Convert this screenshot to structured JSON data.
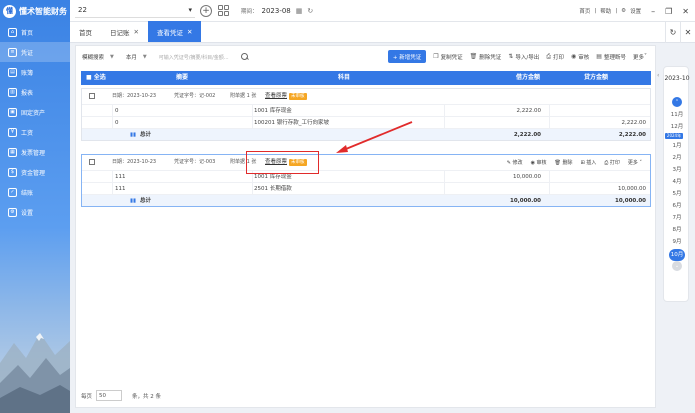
{
  "app": {
    "title": "懂术智能财务",
    "logo_glyph": "懂"
  },
  "sidebar": {
    "items": [
      {
        "label": "首页",
        "icon": "home-icon"
      },
      {
        "label": "凭证",
        "icon": "voucher-icon"
      },
      {
        "label": "账簿",
        "icon": "book-icon"
      },
      {
        "label": "报表",
        "icon": "report-icon"
      },
      {
        "label": "固定资产",
        "icon": "asset-icon"
      },
      {
        "label": "工资",
        "icon": "salary-icon"
      },
      {
        "label": "发票管理",
        "icon": "invoice-icon"
      },
      {
        "label": "资金管理",
        "icon": "fund-icon"
      },
      {
        "label": "结账",
        "icon": "close-account-icon"
      },
      {
        "label": "设置",
        "icon": "settings-icon"
      }
    ]
  },
  "topbar": {
    "org": "22",
    "period_label": "期间：",
    "period": "2023-08",
    "links": [
      "首页",
      "帮助",
      "设置"
    ]
  },
  "tabs": [
    {
      "label": "首页",
      "active": false,
      "closable": false
    },
    {
      "label": "日记账",
      "active": false,
      "closable": true
    },
    {
      "label": "查看凭证",
      "active": true,
      "closable": true
    }
  ],
  "toolbar": {
    "filter_mode": "模糊搜索",
    "period_filter": "本月",
    "search_placeholder": "可输入凭证号/摘要/科目/金额...",
    "new_voucher": "+ 新增凭证",
    "actions": [
      "复制凭证",
      "删除凭证",
      "导入/导出",
      "打印",
      "审核",
      "整理断号",
      "更多"
    ]
  },
  "table": {
    "headers": {
      "select_all": "■ 全选",
      "summary": "摘要",
      "subject": "科目",
      "debit": "借方金额",
      "credit": "贷方金额"
    },
    "vouchers": [
      {
        "date": "日期：2023-10-23",
        "number": "凭证字号：记-002",
        "attachments": "附单据 1 张",
        "view_link": "查看原票",
        "status": "未审核",
        "rows": [
          {
            "summary": "0",
            "subject": "1001 库存现金",
            "debit": "2,222.00",
            "credit": ""
          },
          {
            "summary": "0",
            "subject": "100201 银行存款_工行向家坡",
            "debit": "",
            "credit": "2,222.00"
          }
        ],
        "total_label": "总计",
        "total_debit": "2,222.00",
        "total_credit": "2,222.00"
      },
      {
        "date": "日期：2023-10-23",
        "number": "凭证字号：记-003",
        "attachments": "附单据 1 张",
        "view_link": "查看原票",
        "status": "未审核",
        "row_actions": [
          "修改",
          "审核",
          "删除",
          "插入",
          "打印",
          "更多"
        ],
        "rows": [
          {
            "summary": "111",
            "subject": "1001 库存现金",
            "debit": "10,000.00",
            "credit": ""
          },
          {
            "summary": "111",
            "subject": "2501 长期借款",
            "debit": "",
            "credit": "10,000.00"
          }
        ],
        "total_label": "总计",
        "total_debit": "10,000.00",
        "total_credit": "10,000.00"
      }
    ]
  },
  "footer": {
    "per_page_label": "每页",
    "per_page": "50",
    "count_text": "条，共 2 条"
  },
  "months_panel": {
    "year": "2023-10",
    "months": [
      "11月",
      "12月",
      "1月",
      "2月",
      "3月",
      "4月",
      "5月",
      "6月",
      "7月",
      "8月",
      "9月"
    ],
    "year_tag": "2024年",
    "current": "10月"
  },
  "colors": {
    "primary": "#3478e5",
    "badge": "#f5a623",
    "annotation": "#e12b2b"
  }
}
